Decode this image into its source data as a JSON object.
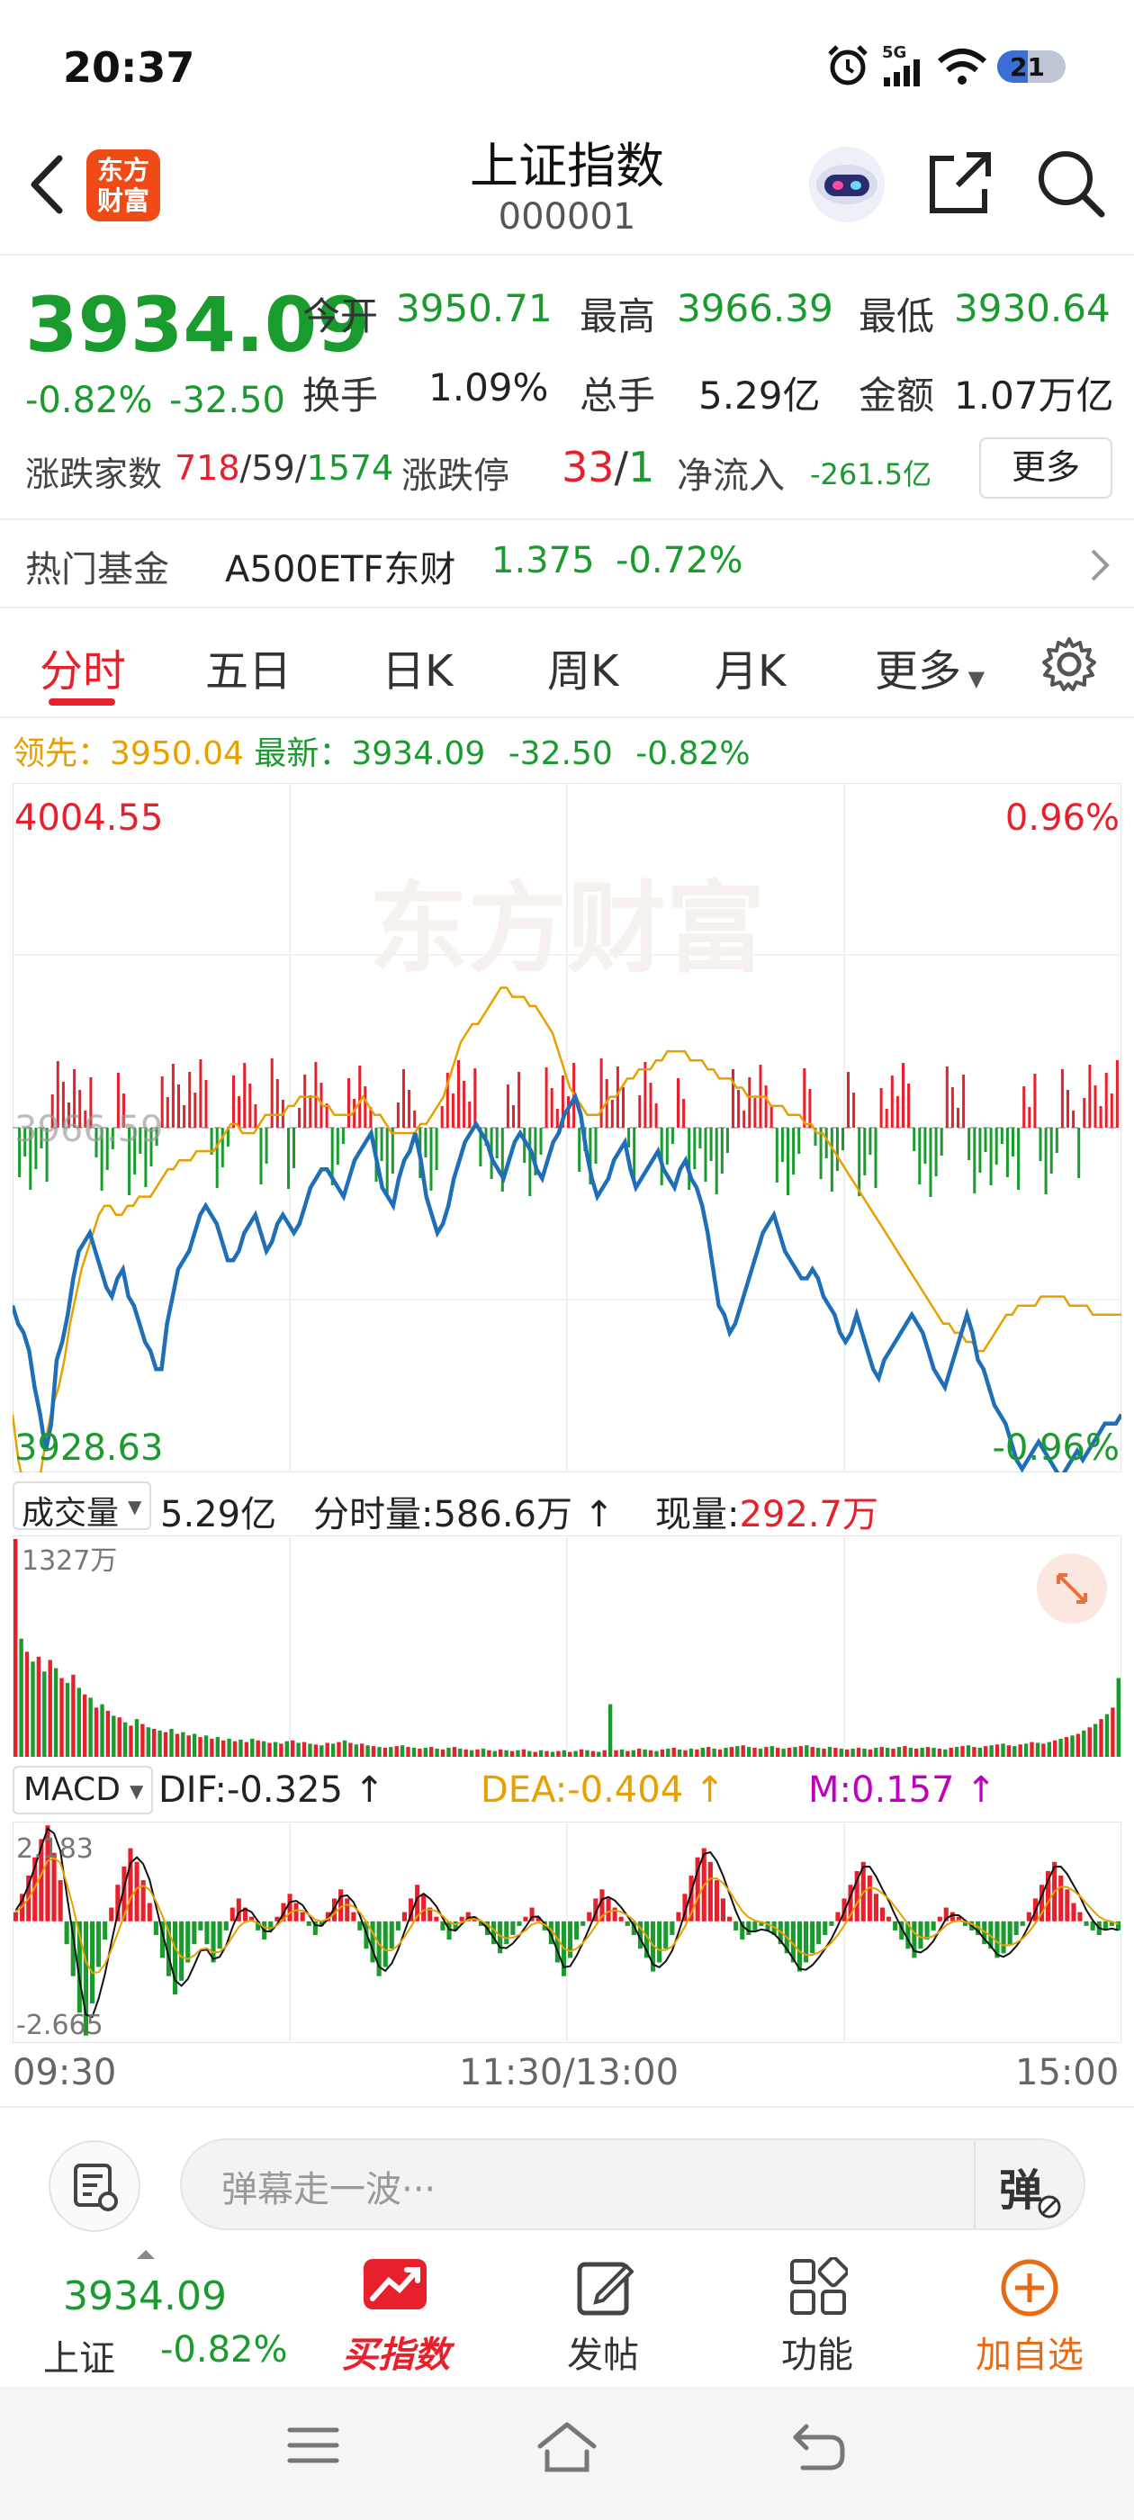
{
  "status_bar": {
    "time": "20:37",
    "network": "5G",
    "battery": "21"
  },
  "header": {
    "title": "上证指数",
    "code": "000001",
    "logo_line1": "东方",
    "logo_line2": "财富"
  },
  "quote": {
    "price": "3934.09",
    "change_pct": "-0.82%",
    "change": "-32.50",
    "open_label": "今开",
    "open": "3950.71",
    "high_label": "最高",
    "high": "3966.39",
    "low_label": "最低",
    "low": "3930.64",
    "turnover_label": "换手",
    "turnover": "1.09%",
    "volume_label": "总手",
    "volume": "5.29亿",
    "amount_label": "金额",
    "amount": "1.07万亿",
    "breadth_label": "涨跌家数",
    "breadth_up": "718",
    "breadth_flat": "59",
    "breadth_down": "1574",
    "limit_label": "涨跌停",
    "limit_up": "33",
    "limit_down": "1",
    "inflow_label": "净流入",
    "inflow": "-261.5亿",
    "more": "更多"
  },
  "fund": {
    "label": "热门基金",
    "name": "A500ETF东财",
    "price": "1.375",
    "change": "-0.72%"
  },
  "tabs": [
    {
      "label": "分时",
      "active": true
    },
    {
      "label": "五日"
    },
    {
      "label": "日K"
    },
    {
      "label": "周K"
    },
    {
      "label": "月K"
    },
    {
      "label": "更多"
    }
  ],
  "info_line": {
    "lead_label": "领先：",
    "lead": "3950.04",
    "latest_label": "最新：",
    "latest": "3934.09",
    "change": "-32.50",
    "pct": "-0.82%"
  },
  "watermark": "东方财富",
  "price_chart": {
    "high": "4004.55",
    "low": "3928.63",
    "high_pct": "0.96%",
    "low_pct": "-0.96%",
    "mid": "3966.59"
  },
  "volume_info": {
    "select": "成交量",
    "total": "5.29亿",
    "seg_label": "分时量:",
    "seg": "586.6万",
    "now_label": "现量:",
    "now": "292.7万",
    "max": "1327万"
  },
  "macd_info": {
    "select": "MACD",
    "dif": "DIF:-0.325",
    "dea": "DEA:-0.404",
    "m": "M:0.157",
    "top": "2.183",
    "bottom": "-2.665"
  },
  "time_axis": {
    "start": "09:30",
    "mid": "11:30/13:00",
    "end": "15:00"
  },
  "danmu": {
    "placeholder": "弹幕走一波···",
    "danmu_button": "弹"
  },
  "bottom_nav": {
    "index_price": "3934.09",
    "index_name": "上证",
    "index_change": "-0.82%",
    "buy_index": "买指数",
    "post": "发帖",
    "function": "功能",
    "add_watch": "加自选"
  },
  "chart_data": [
    {
      "type": "line",
      "title": "",
      "x_range": [
        "09:30",
        "15:00"
      ],
      "ylim": [
        3928.63,
        4004.55
      ],
      "reference_close": 3966.59,
      "series": [
        {
          "name": "最新",
          "color": "#1f6fb8",
          "y": [
            3947,
            3945,
            3944,
            3942,
            3938,
            3935,
            3931,
            3934,
            3941,
            3943,
            3946,
            3950,
            3953,
            3954,
            3955,
            3953,
            3951,
            3949,
            3948,
            3950,
            3951,
            3948,
            3947,
            3945,
            3943,
            3942,
            3940,
            3940,
            3945,
            3948,
            3951,
            3952,
            3953,
            3955,
            3957,
            3958,
            3957,
            3956,
            3954,
            3952,
            3952,
            3953,
            3955,
            3956,
            3957,
            3955,
            3953,
            3954,
            3956,
            3957,
            3956,
            3955,
            3956,
            3958,
            3960,
            3961,
            3962,
            3962,
            3961,
            3960,
            3959,
            3961,
            3963,
            3964,
            3965,
            3966,
            3963,
            3960,
            3959,
            3958,
            3961,
            3963,
            3964,
            3966,
            3963,
            3959,
            3957,
            3955,
            3956,
            3958,
            3961,
            3963,
            3965,
            3966,
            3967,
            3966,
            3965,
            3963,
            3962,
            3961,
            3963,
            3965,
            3966,
            3965,
            3964,
            3962,
            3961,
            3963,
            3965,
            3966,
            3968,
            3969,
            3970,
            3968,
            3964,
            3961,
            3959,
            3960,
            3961,
            3963,
            3964,
            3965,
            3962,
            3960,
            3961,
            3962,
            3963,
            3964,
            3962,
            3961,
            3960,
            3962,
            3963,
            3961,
            3960,
            3958,
            3955,
            3951,
            3947,
            3946,
            3944,
            3945,
            3947,
            3949,
            3951,
            3953,
            3955,
            3956,
            3957,
            3955,
            3953,
            3952,
            3951,
            3950,
            3950,
            3951,
            3950,
            3948,
            3947,
            3946,
            3944,
            3943,
            3944,
            3946,
            3944,
            3942,
            3940,
            3939,
            3941,
            3942,
            3943,
            3944,
            3945,
            3946,
            3945,
            3944,
            3942,
            3940,
            3939,
            3938,
            3940,
            3942,
            3944,
            3946,
            3944,
            3941,
            3940,
            3938,
            3936,
            3935,
            3934,
            3932,
            3930,
            3929,
            3930,
            3931,
            3932,
            3931,
            3930,
            3929,
            3928,
            3929,
            3930,
            3931,
            3930,
            3931,
            3932,
            3933,
            3934,
            3934,
            3934,
            3935
          ]
        },
        {
          "name": "领先",
          "color": "#e8a000",
          "y": [
            3935,
            3930,
            3927,
            3925,
            3926,
            3929,
            3933,
            3936,
            3938,
            3941,
            3945,
            3948,
            3951,
            3953,
            3955,
            3957,
            3958,
            3958,
            3957,
            3957,
            3958,
            3958,
            3959,
            3959,
            3959,
            3960,
            3961,
            3962,
            3962,
            3963,
            3963,
            3963,
            3964,
            3964,
            3964,
            3964,
            3965,
            3966,
            3967,
            3967,
            3966,
            3966,
            3966,
            3967,
            3968,
            3968,
            3968,
            3968,
            3969,
            3969,
            3970,
            3970,
            3970,
            3970,
            3969,
            3969,
            3968,
            3968,
            3968,
            3968,
            3969,
            3970,
            3969,
            3968,
            3968,
            3967,
            3966,
            3966,
            3966,
            3966,
            3966,
            3967,
            3967,
            3968,
            3969,
            3970,
            3972,
            3974,
            3976,
            3977,
            3978,
            3978,
            3979,
            3980,
            3981,
            3982,
            3982,
            3981,
            3981,
            3981,
            3980,
            3980,
            3979,
            3978,
            3977,
            3975,
            3973,
            3971,
            3970,
            3969,
            3968,
            3968,
            3968,
            3969,
            3970,
            3970,
            3971,
            3972,
            3972,
            3973,
            3973,
            3973,
            3974,
            3974,
            3975,
            3975,
            3975,
            3975,
            3974,
            3974,
            3974,
            3973,
            3973,
            3972,
            3972,
            3972,
            3971,
            3971,
            3970,
            3970,
            3970,
            3970,
            3969,
            3969,
            3969,
            3968,
            3968,
            3968,
            3967,
            3967,
            3966,
            3966,
            3965,
            3964,
            3963,
            3962,
            3961,
            3960,
            3959,
            3958,
            3957,
            3956,
            3955,
            3954,
            3953,
            3952,
            3951,
            3950,
            3949,
            3948,
            3947,
            3946,
            3945,
            3945,
            3944,
            3944,
            3943,
            3943,
            3942,
            3942,
            3943,
            3944,
            3945,
            3946,
            3946,
            3947,
            3947,
            3947,
            3947,
            3948,
            3948,
            3948,
            3948,
            3948,
            3947,
            3947,
            3947,
            3947,
            3946,
            3946,
            3946,
            3946,
            3946,
            3946
          ]
        }
      ]
    },
    {
      "type": "bar",
      "title": "",
      "ylim": [
        0,
        1327
      ],
      "ylabel": "万",
      "values": [
        1327,
        720,
        640,
        580,
        610,
        520,
        590,
        540,
        480,
        450,
        500,
        420,
        380,
        360,
        300,
        320,
        280,
        250,
        240,
        210,
        190,
        230,
        200,
        180,
        170,
        160,
        150,
        170,
        140,
        150,
        130,
        140,
        120,
        130,
        110,
        120,
        100,
        110,
        95,
        105,
        90,
        110,
        100,
        95,
        85,
        90,
        80,
        95,
        100,
        85,
        90,
        80,
        75,
        70,
        85,
        80,
        90,
        100,
        85,
        75,
        80,
        70,
        65,
        60,
        55,
        60,
        65,
        70,
        60,
        55,
        50,
        55,
        60,
        50,
        45,
        55,
        60,
        50,
        45,
        40,
        45,
        50,
        40,
        35,
        45,
        40,
        35,
        40,
        45,
        35,
        30,
        40,
        35,
        30,
        35,
        40,
        30,
        35,
        45,
        40,
        35,
        30,
        40,
        320,
        40,
        45,
        35,
        40,
        50,
        45,
        40,
        35,
        45,
        50,
        55,
        45,
        40,
        50,
        45,
        55,
        60,
        50,
        45,
        55,
        60,
        65,
        70,
        60,
        55,
        50,
        60,
        65,
        55,
        50,
        55,
        60,
        65,
        70,
        60,
        55,
        50,
        60,
        55,
        50,
        45,
        50,
        55,
        50,
        45,
        55,
        60,
        55,
        50,
        60,
        65,
        55,
        50,
        55,
        60,
        55,
        50,
        45,
        55,
        60,
        65,
        70,
        60,
        55,
        65,
        70,
        75,
        80,
        70,
        65,
        75,
        80,
        90,
        85,
        80,
        90,
        100,
        110,
        120,
        130,
        140,
        160,
        180,
        200,
        230,
        260,
        300,
        480
      ],
      "colors": "alternating red/green by direction"
    },
    {
      "type": "bar",
      "title": "",
      "ylim": [
        -2.665,
        2.183
      ],
      "series": [
        {
          "name": "DIF",
          "value": -0.325,
          "color": "#111111"
        },
        {
          "name": "DEA",
          "value": -0.404,
          "color": "#e8a000"
        },
        {
          "name": "M",
          "value": 0.157,
          "color": "#c000c0"
        }
      ],
      "histogram": [
        0.2,
        0.6,
        1.0,
        1.4,
        1.8,
        2.1,
        1.5,
        0.9,
        -0.5,
        -1.2,
        -2.0,
        -2.5,
        -1.8,
        -1.0,
        -0.4,
        0.3,
        0.8,
        1.2,
        1.6,
        1.3,
        0.9,
        0.4,
        -0.3,
        -0.8,
        -1.2,
        -1.6,
        -1.3,
        -0.9,
        -0.5,
        -0.2,
        -0.5,
        -0.9,
        -0.6,
        -0.2,
        0.3,
        0.5,
        0.3,
        0.1,
        -0.2,
        -0.4,
        -0.2,
        0.1,
        0.4,
        0.6,
        0.4,
        0.2,
        -0.1,
        -0.3,
        -0.1,
        0.2,
        0.5,
        0.7,
        0.5,
        0.2,
        -0.2,
        -0.6,
        -0.9,
        -1.2,
        -1.0,
        -0.6,
        -0.2,
        0.2,
        0.5,
        0.8,
        0.6,
        0.3,
        0.1,
        -0.2,
        -0.4,
        -0.2,
        0.1,
        0.2,
        0.1,
        -0.1,
        -0.3,
        -0.5,
        -0.7,
        -0.5,
        -0.3,
        -0.1,
        0.1,
        0.3,
        0.1,
        -0.2,
        -0.5,
        -0.9,
        -1.2,
        -0.8,
        -0.4,
        -0.1,
        0.2,
        0.5,
        0.7,
        0.5,
        0.3,
        0.1,
        -0.1,
        -0.3,
        -0.6,
        -0.8,
        -1.1,
        -0.9,
        -0.6,
        -0.3,
        0.2,
        0.6,
        1.0,
        1.4,
        1.6,
        1.3,
        0.9,
        0.5,
        0.1,
        -0.2,
        -0.4,
        -0.3,
        -0.2,
        -0.1,
        -0.2,
        -0.3,
        -0.5,
        -0.7,
        -0.9,
        -1.1,
        -0.9,
        -0.7,
        -0.5,
        -0.3,
        -0.1,
        0.2,
        0.5,
        0.8,
        1.1,
        1.3,
        1.0,
        0.6,
        0.3,
        0.1,
        -0.2,
        -0.4,
        -0.6,
        -0.8,
        -0.6,
        -0.4,
        -0.2,
        0.1,
        0.3,
        0.2,
        0.1,
        -0.1,
        -0.2,
        -0.3,
        -0.5,
        -0.6,
        -0.8,
        -0.7,
        -0.5,
        -0.3,
        -0.1,
        0.2,
        0.5,
        0.8,
        1.1,
        1.3,
        1.0,
        0.7,
        0.4,
        0.2,
        -0.1,
        -0.2,
        -0.3,
        -0.2,
        -0.1,
        -0.2
      ]
    }
  ]
}
